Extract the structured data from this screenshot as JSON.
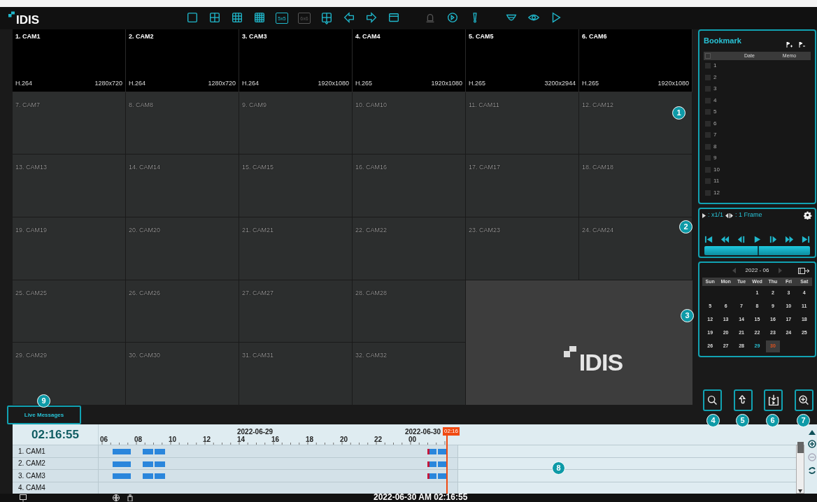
{
  "toolbar": {
    "logo": "IDIS",
    "groups": [
      [
        {
          "kind": "layout-1",
          "disabled": false
        },
        {
          "kind": "layout-4",
          "disabled": false
        },
        {
          "kind": "layout-9",
          "disabled": false
        },
        {
          "kind": "layout-16",
          "disabled": false
        },
        {
          "kind": "layout-text",
          "label": "5x5",
          "disabled": false
        },
        {
          "kind": "layout-text",
          "label": "6x6",
          "disabled": true
        },
        {
          "kind": "layout-custom",
          "disabled": false
        },
        {
          "kind": "prev",
          "disabled": false
        },
        {
          "kind": "next",
          "disabled": false
        },
        {
          "kind": "window",
          "disabled": false
        }
      ],
      [
        {
          "kind": "alarm",
          "disabled": true
        },
        {
          "kind": "playback",
          "disabled": false
        },
        {
          "kind": "alert",
          "disabled": false
        }
      ],
      [
        {
          "kind": "dome",
          "disabled": false
        },
        {
          "kind": "eye",
          "disabled": false
        },
        {
          "kind": "play",
          "disabled": false
        }
      ]
    ]
  },
  "cameras": [
    {
      "name": "1. CAM1",
      "live": true,
      "codec": "H.264",
      "resolution": "1280x720"
    },
    {
      "name": "2. CAM2",
      "live": true,
      "codec": "H.264",
      "resolution": "1280x720"
    },
    {
      "name": "3. CAM3",
      "live": true,
      "codec": "H.264",
      "resolution": "1920x1080"
    },
    {
      "name": "4. CAM4",
      "live": true,
      "codec": "H.265",
      "resolution": "1920x1080"
    },
    {
      "name": "5. CAM5",
      "live": true,
      "codec": "H.265",
      "resolution": "3200x2944"
    },
    {
      "name": "6. CAM6",
      "live": true,
      "codec": "H.265",
      "resolution": "1920x1080"
    },
    {
      "name": "7. CAM7",
      "live": false
    },
    {
      "name": "8. CAM8",
      "live": false
    },
    {
      "name": "9. CAM9",
      "live": false
    },
    {
      "name": "10. CAM10",
      "live": false
    },
    {
      "name": "11. CAM11",
      "live": false
    },
    {
      "name": "12. CAM12",
      "live": false
    },
    {
      "name": "13. CAM13",
      "live": false
    },
    {
      "name": "14. CAM14",
      "live": false
    },
    {
      "name": "15. CAM15",
      "live": false
    },
    {
      "name": "16. CAM16",
      "live": false
    },
    {
      "name": "17. CAM17",
      "live": false
    },
    {
      "name": "18. CAM18",
      "live": false
    },
    {
      "name": "19. CAM19",
      "live": false
    },
    {
      "name": "20. CAM20",
      "live": false
    },
    {
      "name": "21. CAM21",
      "live": false
    },
    {
      "name": "22. CAM22",
      "live": false
    },
    {
      "name": "23. CAM23",
      "live": false
    },
    {
      "name": "24. CAM24",
      "live": false
    },
    {
      "name": "25. CAM25",
      "live": false
    },
    {
      "name": "26. CAM26",
      "live": false
    },
    {
      "name": "27. CAM27",
      "live": false
    },
    {
      "name": "28. CAM28",
      "live": false
    },
    {
      "name": "29. CAM29",
      "live": false
    },
    {
      "name": "30. CAM30",
      "live": false
    },
    {
      "name": "31. CAM31",
      "live": false
    },
    {
      "name": "32. CAM32",
      "live": false
    }
  ],
  "logo_tile": {
    "text": "IDIS"
  },
  "live_messages": {
    "label": "Live Messages"
  },
  "bookmark": {
    "title": "Bookmark",
    "columns": [
      "Date",
      "Memo"
    ],
    "header_checked": false,
    "rows": [
      {
        "label": "1",
        "checked": false
      },
      {
        "label": "2",
        "checked": false
      },
      {
        "label": "3",
        "checked": false
      },
      {
        "label": "4",
        "checked": false
      },
      {
        "label": "5",
        "checked": false
      },
      {
        "label": "6",
        "checked": false
      },
      {
        "label": "7",
        "checked": false
      },
      {
        "label": "8",
        "checked": false
      },
      {
        "label": "9",
        "checked": false
      },
      {
        "label": "10",
        "checked": false
      },
      {
        "label": "11",
        "checked": false
      },
      {
        "label": "12",
        "checked": false
      }
    ]
  },
  "playback": {
    "speed": ": x1/1",
    "step": ": 1 Frame",
    "level": 0.5
  },
  "calendar": {
    "month": "2022 - 06",
    "weekdays": [
      "Sun",
      "Mon",
      "Tue",
      "Wed",
      "Thu",
      "Fri",
      "Sat"
    ],
    "weeks": [
      [
        {
          "label": "1",
          "recorded": false,
          "selected": false
        },
        {
          "label": "2",
          "recorded": false,
          "selected": false
        },
        {
          "label": "3",
          "recorded": false,
          "selected": false
        },
        {
          "label": "4",
          "recorded": false,
          "selected": false
        }
      ],
      [
        {
          "label": "5",
          "recorded": false,
          "selected": false
        },
        {
          "label": "6",
          "recorded": false,
          "selected": false
        },
        {
          "label": "7",
          "recorded": false,
          "selected": false
        },
        {
          "label": "8",
          "recorded": false,
          "selected": false
        },
        {
          "label": "9",
          "recorded": false,
          "selected": false
        },
        {
          "label": "10",
          "recorded": false,
          "selected": false
        },
        {
          "label": "11",
          "recorded": false,
          "selected": false
        }
      ],
      [
        {
          "label": "12",
          "recorded": false,
          "selected": false
        },
        {
          "label": "13",
          "recorded": false,
          "selected": false
        },
        {
          "label": "14",
          "recorded": false,
          "selected": false
        },
        {
          "label": "15",
          "recorded": false,
          "selected": false
        },
        {
          "label": "16",
          "recorded": false,
          "selected": false
        },
        {
          "label": "17",
          "recorded": false,
          "selected": false
        },
        {
          "label": "18",
          "recorded": false,
          "selected": false
        }
      ],
      [
        {
          "label": "19",
          "recorded": false,
          "selected": false
        },
        {
          "label": "20",
          "recorded": false,
          "selected": false
        },
        {
          "label": "21",
          "recorded": false,
          "selected": false
        },
        {
          "label": "22",
          "recorded": false,
          "selected": false
        },
        {
          "label": "23",
          "recorded": false,
          "selected": false
        },
        {
          "label": "24",
          "recorded": false,
          "selected": false
        },
        {
          "label": "25",
          "recorded": false,
          "selected": false
        }
      ],
      [
        {
          "label": "26",
          "recorded": false,
          "selected": false
        },
        {
          "label": "27",
          "recorded": false,
          "selected": false
        },
        {
          "label": "28",
          "recorded": false,
          "selected": false
        },
        {
          "label": "29",
          "recorded": true,
          "selected": false
        },
        {
          "label": "30",
          "recorded": false,
          "selected": true
        }
      ]
    ]
  },
  "actions": [
    {
      "kind": "search"
    },
    {
      "kind": "upload"
    },
    {
      "kind": "export"
    },
    {
      "kind": "zoom"
    }
  ],
  "annotations": [
    "1",
    "2",
    "3",
    "4",
    "5",
    "6",
    "7",
    "8",
    "9"
  ],
  "timeline": {
    "clock": "02:16:55",
    "dates": [
      "2022-06-29",
      "2022-06-30"
    ],
    "hours": [
      "06",
      "08",
      "10",
      "12",
      "14",
      "16",
      "18",
      "20",
      "22",
      "00"
    ],
    "cursor": "02:16",
    "channels": [
      {
        "name": "1. CAM1",
        "recorded": true
      },
      {
        "name": "2. CAM2",
        "recorded": true
      },
      {
        "name": "3. CAM3",
        "recorded": true
      },
      {
        "name": "4. CAM4",
        "recorded": false
      }
    ]
  },
  "status_bar": {
    "datetime": "2022-06-30 AM 02:16:55"
  }
}
